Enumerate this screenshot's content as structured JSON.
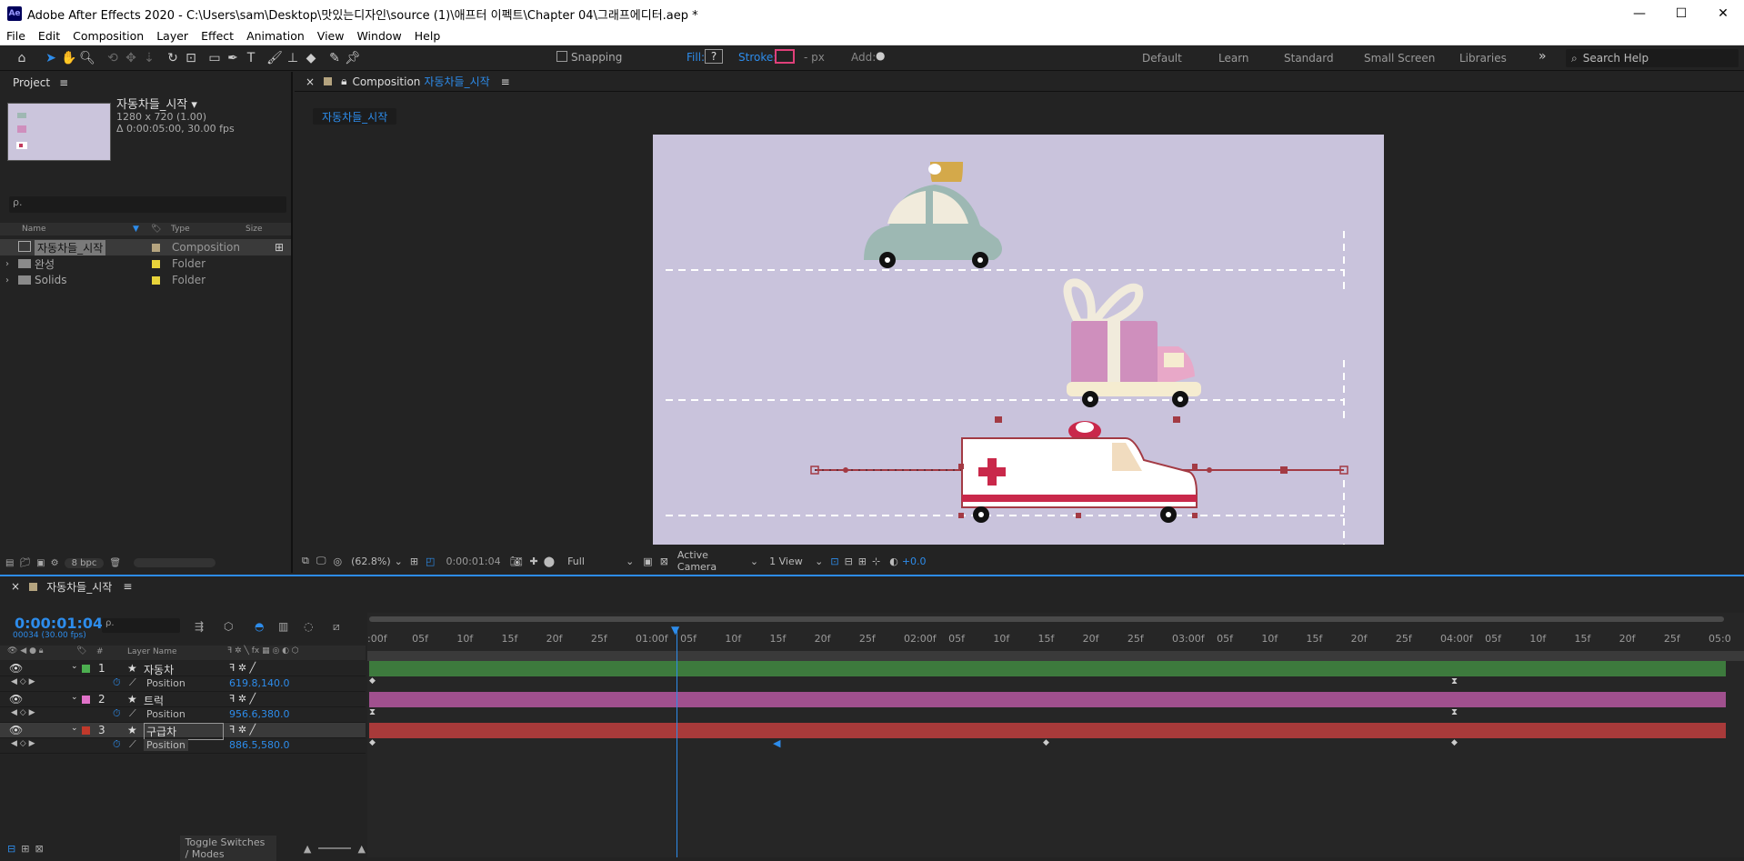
{
  "window": {
    "title": "Adobe After Effects 2020 - C:\\Users\\sam\\Desktop\\맛있는디자인\\source (1)\\애프터 이펙트\\Chapter 04\\그래프에디터.aep *",
    "logo": "Ae",
    "min": "—",
    "max": "☐",
    "close": "✕"
  },
  "menu": [
    "File",
    "Edit",
    "Composition",
    "Layer",
    "Effect",
    "Animation",
    "View",
    "Window",
    "Help"
  ],
  "toolbar": {
    "snapping": "Snapping",
    "fill": "Fill:",
    "fill_value": "?",
    "stroke": "Stroke:",
    "px": "- px",
    "add": "Add:",
    "workspaces": [
      "Default",
      "Learn",
      "Standard",
      "Small Screen",
      "Libraries"
    ],
    "more": "»",
    "search": "Search Help"
  },
  "project": {
    "tab": "Project",
    "comp_name": "자동차들_시작",
    "comp_res": "1280 x 720 (1.00)",
    "comp_dur": "Δ 0:00:05:00, 30.00 fps",
    "search": "ρ.",
    "cols": [
      "Name",
      "Type",
      "Size"
    ],
    "bpc": "8 bpc",
    "items": [
      {
        "name": "자동차들_시작",
        "type": "Composition",
        "color": "#b5a47f"
      },
      {
        "name": "완성",
        "type": "Folder",
        "color": "#e8d33a"
      },
      {
        "name": "Solids",
        "type": "Folder",
        "color": "#e8d33a"
      }
    ]
  },
  "comp": {
    "tab": "Composition",
    "tab_name": "자동차들_시작",
    "crumb": "자동차들_시작",
    "zoom": "(62.8%)",
    "time": "0:00:01:04",
    "res": "Full",
    "camera": "Active Camera",
    "views": "1 View",
    "exposure": "+0.0"
  },
  "timeline": {
    "tab": "자동차들_시작",
    "timecode": "0:00:01:04",
    "timecode_sub": "00034 (30.00 fps)",
    "search": "ρ.",
    "head_name": "Layer Name",
    "toggle": "Toggle Switches / Modes",
    "ticks": [
      ":00f",
      "05f",
      "10f",
      "15f",
      "20f",
      "25f",
      "01:00f",
      "05f",
      "10f",
      "15f",
      "20f",
      "25f",
      "02:00f",
      "05f",
      "10f",
      "15f",
      "20f",
      "25f",
      "03:00f",
      "05f",
      "10f",
      "15f",
      "20f",
      "25f",
      "04:00f",
      "05f",
      "10f",
      "15f",
      "20f",
      "25f",
      "05:0"
    ],
    "layers": [
      {
        "num": "1",
        "name": "자동차",
        "color": "#4caf50",
        "bar": "#3d7a3d",
        "prop": "Position",
        "value": "619.8,140.0"
      },
      {
        "num": "2",
        "name": "트럭",
        "color": "#e072c8",
        "bar": "#a0508e",
        "prop": "Position",
        "value": "956.6,380.0"
      },
      {
        "num": "3",
        "name": "구급차",
        "color": "#c0392b",
        "bar": "#a83a3a",
        "prop": "Position",
        "value": "886.5,580.0"
      }
    ]
  }
}
